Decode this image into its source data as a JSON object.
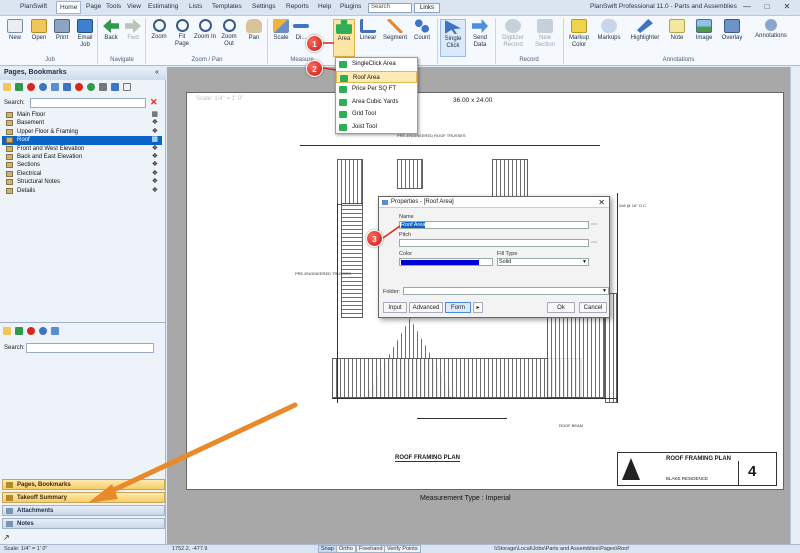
{
  "menu": {
    "items": [
      "PlanSwift",
      "Home",
      "Page",
      "Tools",
      "View",
      "Estimating",
      "Lists",
      "Templates",
      "Settings",
      "Reports",
      "Help",
      "Plugins"
    ],
    "search_placeholder": "Search",
    "links_label": "Links",
    "app_title": "PlanSwift Professional 11.0 - Parts and Assemblies"
  },
  "ribbon": {
    "job": [
      "New",
      "Open",
      "Print",
      "Email Job"
    ],
    "navigate": [
      "Back",
      "Fwd"
    ],
    "zoom": [
      "Zoom",
      "Fit Page",
      "Zoom In",
      "Zoom Out",
      "Pan"
    ],
    "measure": [
      "Scale",
      "Di..."
    ],
    "takeoff": [
      "Area",
      "Linear",
      "Segment",
      "Count"
    ],
    "data": [
      "Single Click",
      "Send Data"
    ],
    "record": [
      "Digitizer Record",
      "New Section"
    ],
    "annotations": [
      "Markup Color",
      "Markups",
      "Highlighter",
      "Note",
      "Image",
      "Overlay",
      "Annotations"
    ],
    "group_labels": {
      "job": "Job",
      "navigate": "Navigate",
      "zoom": "Zoom / Pan",
      "measure": "Measure",
      "takeoff": "Takeoff",
      "record": "Record",
      "annotations": "Annotations"
    }
  },
  "dropdown": {
    "items": [
      "SingleClick Area",
      "Roof Area",
      "Price Per SQ FT",
      "Area Cubic Yards",
      "Grid Tool",
      "Joist Tool"
    ],
    "highlighted_index": 1
  },
  "left_pane": {
    "header": "Pages, Bookmarks",
    "search_label": "Search:",
    "tree": [
      "Main Floor",
      "Basement",
      "Upper Floor & Framing",
      "Roof",
      "Front and West Elevation",
      "Back and East Elevation",
      "Sections",
      "Electrical",
      "Structural Notes",
      "Details"
    ],
    "selected_index": 3,
    "lower_search_label": "Search:",
    "panels": [
      "Pages, Bookmarks",
      "Takeoff Summary",
      "Attachments",
      "Notes"
    ]
  },
  "canvas": {
    "scale_label": "Scale: 1/4\" = 1' 0\"",
    "sheet_size": "36.00 x 24.00",
    "measurement_type": "Measurement Type : Imperial",
    "drawing_title": "ROOF FRAMING PLAN",
    "title_block_title": "ROOF FRAMING PLAN",
    "title_block_client": "BLAKE RESIDENCE",
    "sheet_number": "4"
  },
  "dialog": {
    "title": "Properties - [Roof Area]",
    "name_label": "Name",
    "name_value": "Roof Area",
    "pitch_label": "Pitch",
    "color_label": "Color",
    "fill_label": "Fill Type",
    "fill_value": "Solid",
    "folder_label": "Folder:",
    "buttons": [
      "Input",
      "Advanced",
      "Form"
    ],
    "ok_label": "Ok",
    "cancel_label": "Cancel"
  },
  "badges": [
    "1",
    "2",
    "3"
  ],
  "status": {
    "scale": "Scale: 1/4\" = 1' 0\"",
    "coords": "1752.2, -477.9",
    "buttons": [
      "Snap",
      "Ortho",
      "Freehand",
      "Verify Points"
    ],
    "path": "\\\\Storage\\Local\\Jobs\\Parts and Assemblies\\Pages\\Roof"
  },
  "colors": {
    "accent": "#0a64c8",
    "badge": "#d9261c",
    "arrow": "#e8892a",
    "swatch": "#0000dd"
  }
}
